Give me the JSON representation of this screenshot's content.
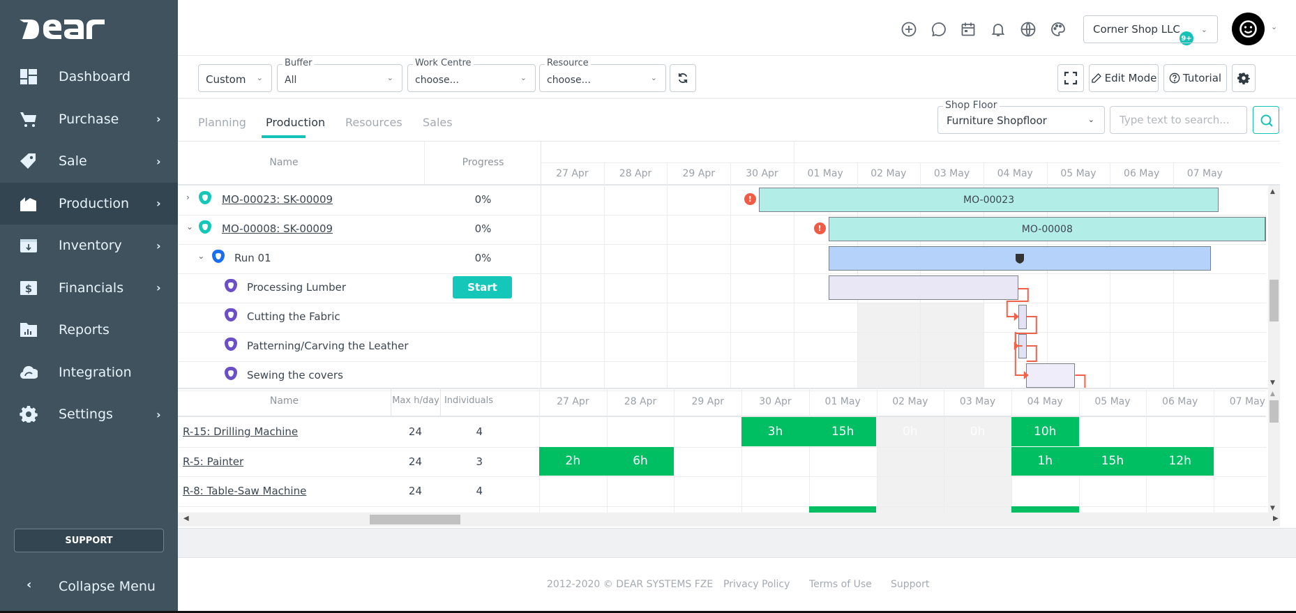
{
  "app": {
    "brand": "DEAR"
  },
  "sidebar": {
    "items": [
      {
        "label": "Dashboard",
        "icon": "dashboard-icon",
        "has_submenu": false,
        "active": false
      },
      {
        "label": "Purchase",
        "icon": "cart-icon",
        "has_submenu": true,
        "active": false
      },
      {
        "label": "Sale",
        "icon": "tag-icon",
        "has_submenu": true,
        "active": false
      },
      {
        "label": "Production",
        "icon": "factory-icon",
        "has_submenu": true,
        "active": true
      },
      {
        "label": "Inventory",
        "icon": "inventory-box-icon",
        "has_submenu": true,
        "active": false
      },
      {
        "label": "Financials",
        "icon": "dollar-icon",
        "has_submenu": true,
        "active": false
      },
      {
        "label": "Reports",
        "icon": "reports-folder-icon",
        "has_submenu": false,
        "active": false
      },
      {
        "label": "Integration",
        "icon": "cloud-icon",
        "has_submenu": false,
        "active": false
      },
      {
        "label": "Settings",
        "icon": "gear-icon",
        "has_submenu": true,
        "active": false
      }
    ],
    "support_label": "SUPPORT",
    "collapse_label": "Collapse Menu"
  },
  "header": {
    "icons": [
      "add-circle-icon",
      "chat-icon",
      "calendar-icon",
      "bell-icon",
      "globe-icon",
      "palette-icon"
    ],
    "notification_badge": "9+",
    "company": "Corner Shop LLC"
  },
  "toolbar": {
    "view_select": "Custom",
    "buffer": {
      "legend": "Buffer",
      "value": "All"
    },
    "work_centre": {
      "legend": "Work Centre",
      "value": "choose..."
    },
    "resource": {
      "legend": "Resource",
      "value": "choose..."
    },
    "edit_mode_label": "Edit Mode",
    "tutorial_label": "Tutorial"
  },
  "tabs": [
    {
      "label": "Planning",
      "active": false
    },
    {
      "label": "Production",
      "active": true
    },
    {
      "label": "Resources",
      "active": false
    },
    {
      "label": "Sales",
      "active": false
    }
  ],
  "shop_floor": {
    "legend": "Shop Floor",
    "value": "Furniture Shopfloor"
  },
  "search": {
    "placeholder": "Type text to search..."
  },
  "gantt": {
    "columns": {
      "name": "Name",
      "progress": "Progress"
    },
    "dates": [
      "27 Apr",
      "28 Apr",
      "29 Apr",
      "30 Apr",
      "01 May",
      "02 May",
      "03 May",
      "04 May",
      "05 May",
      "06 May",
      "07 May"
    ],
    "weekend_dates": [
      "02 May",
      "03 May"
    ],
    "rows": [
      {
        "name": "MO-00023: SK-00009",
        "progress": "0%",
        "level": 0,
        "expanded": false,
        "link": true,
        "status_color": "#14c7b9"
      },
      {
        "name": "MO-00008: SK-00009",
        "progress": "0%",
        "level": 0,
        "expanded": true,
        "link": true,
        "status_color": "#14c7b9"
      },
      {
        "name": "Run 01",
        "progress": "0%",
        "level": 1,
        "expanded": true,
        "link": false,
        "status_color": "#1a6ff0"
      },
      {
        "name": "Processing Lumber",
        "progress": "",
        "level": 2,
        "action": "Start",
        "link": false,
        "status_color": "#6a4fc8"
      },
      {
        "name": "Cutting the Fabric",
        "progress": "",
        "level": 2,
        "link": false,
        "status_color": "#6a4fc8"
      },
      {
        "name": "Patterning/Carving the Leather",
        "progress": "",
        "level": 2,
        "link": false,
        "status_color": "#6a4fc8"
      },
      {
        "name": "Sewing the covers",
        "progress": "",
        "level": 2,
        "link": false,
        "status_color": "#6a4fc8"
      }
    ],
    "bars": [
      {
        "row": 0,
        "label": "MO-00023",
        "start": "30 Apr",
        "end": "07 May",
        "color": "#b3ede8",
        "warning": true
      },
      {
        "row": 1,
        "label": "MO-00008",
        "start": "01 May",
        "end": "07 May+",
        "color": "#b3ede8",
        "warning": true
      },
      {
        "row": 2,
        "label": "",
        "start": "01 May",
        "end": "07 May",
        "color": "#b5d2fb",
        "warning": false
      },
      {
        "row": 3,
        "label": "",
        "start": "01 May",
        "end": "04 May",
        "color": "#e9e7f5",
        "warning": false
      },
      {
        "row": 4,
        "label": "",
        "start": "04 May",
        "end": "04 May",
        "color": "#e4e1f4",
        "warning": false
      },
      {
        "row": 5,
        "label": "",
        "start": "04 May",
        "end": "04 May",
        "color": "#e4e1f4",
        "warning": false
      },
      {
        "row": 6,
        "label": "",
        "start": "04 May",
        "end": "05 May",
        "color": "#efedf9",
        "warning": false
      }
    ],
    "dependency_color": "#f2604a"
  },
  "resources": {
    "columns": {
      "name": "Name",
      "max_hday": "Max h/day",
      "individuals": "Individuals"
    },
    "rows": [
      {
        "name": "R-15: Drilling Machine",
        "max_hday": "24",
        "individuals": "4",
        "loads": {
          "30 Apr": "3h",
          "01 May": "15h",
          "02 May": "0h",
          "03 May": "0h",
          "04 May": "10h"
        }
      },
      {
        "name": "R-5: Painter",
        "max_hday": "24",
        "individuals": "3",
        "loads": {
          "27 Apr": "2h",
          "28 Apr": "6h",
          "04 May": "1h",
          "05 May": "15h",
          "06 May": "12h"
        }
      },
      {
        "name": "R-8: Table-Saw Machine",
        "max_hday": "24",
        "individuals": "4",
        "loads": {
          "01 May": "",
          "04 May": ""
        }
      }
    ],
    "load_color": "#00bf63"
  },
  "footer": {
    "copyright": "2012-2020 © DEAR SYSTEMS FZE",
    "links": [
      "Privacy Policy",
      "Terms of Use",
      "Support"
    ]
  }
}
